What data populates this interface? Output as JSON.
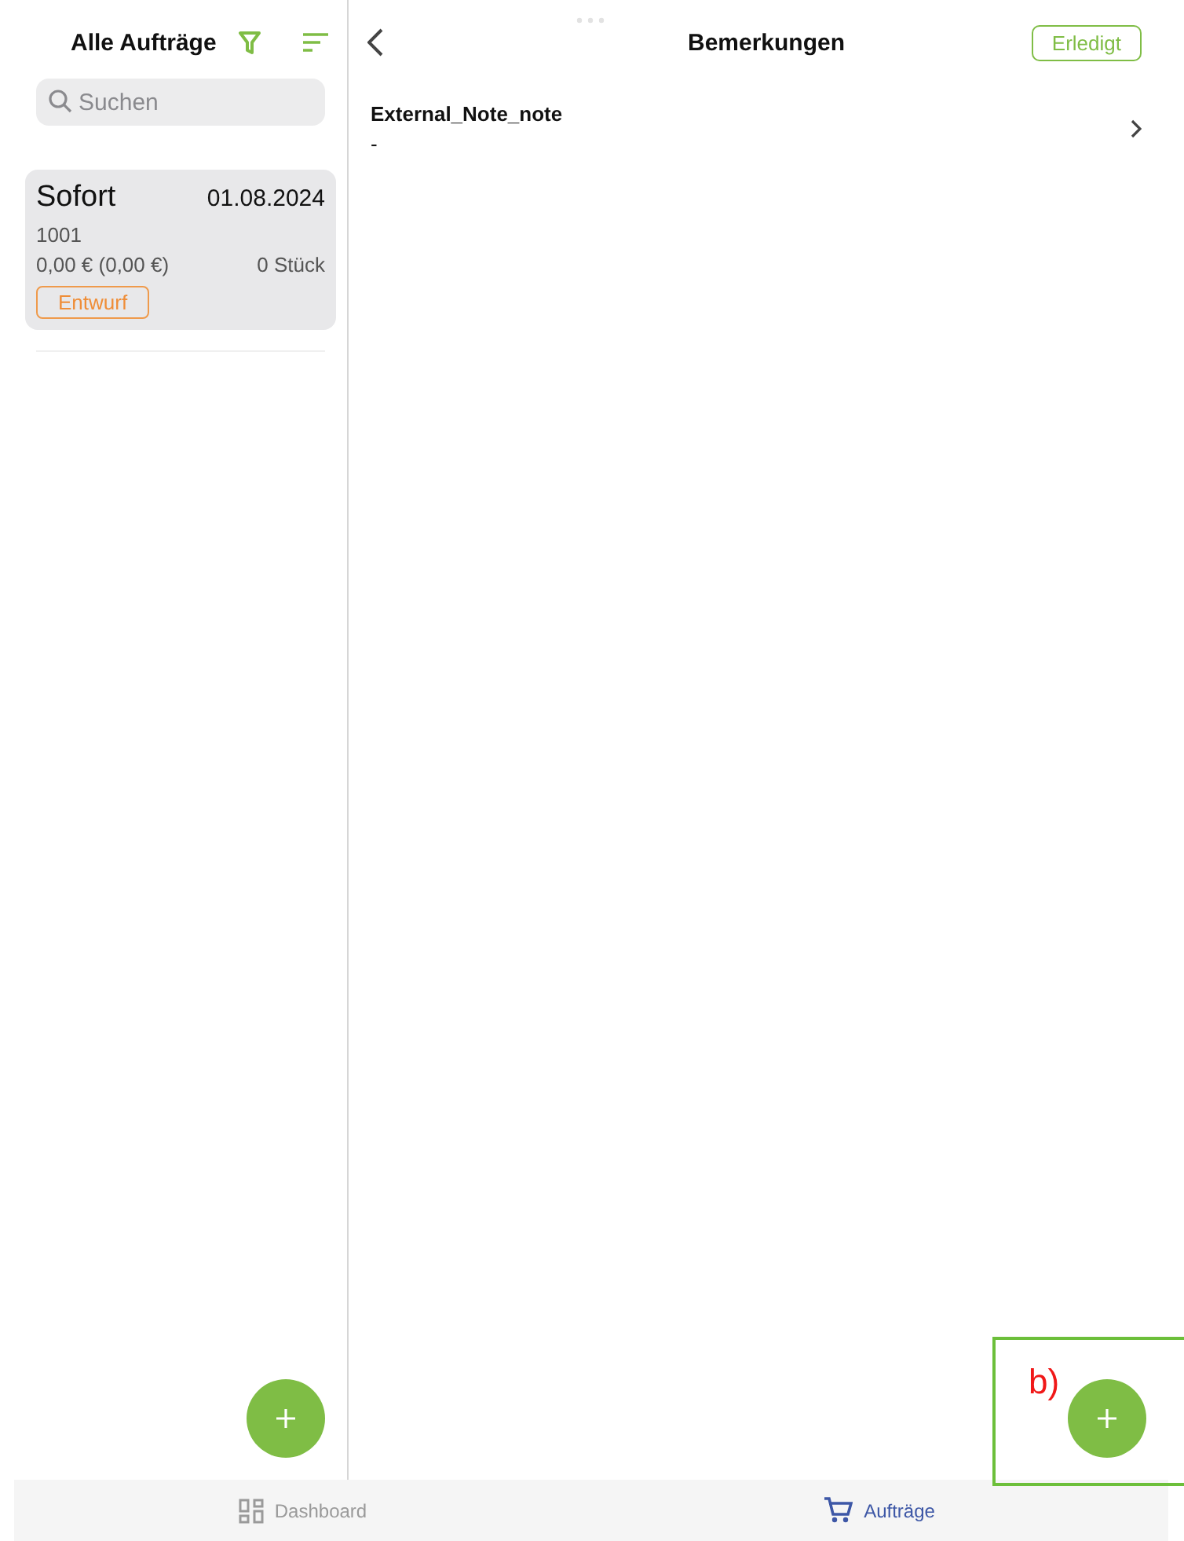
{
  "sidebar": {
    "title": "Alle Aufträge",
    "search": {
      "placeholder": "Suchen"
    },
    "orders": [
      {
        "name": "Sofort",
        "date": "01.08.2024",
        "number": "1001",
        "amount": "0,00 € (0,00 €)",
        "quantity": "0 Stück",
        "status": "Entwurf",
        "selected": true
      }
    ]
  },
  "detail": {
    "title": "Bemerkungen",
    "done_button": "Erledigt",
    "notes": [
      {
        "label": "External_Note_note",
        "value": "-"
      }
    ]
  },
  "annotation": {
    "label": "b)"
  },
  "tab_bar": {
    "tabs": [
      {
        "label": "Dashboard",
        "kind": "dashboard",
        "selected": false
      },
      {
        "label": "Aufträge",
        "kind": "orders",
        "selected": true
      }
    ]
  }
}
